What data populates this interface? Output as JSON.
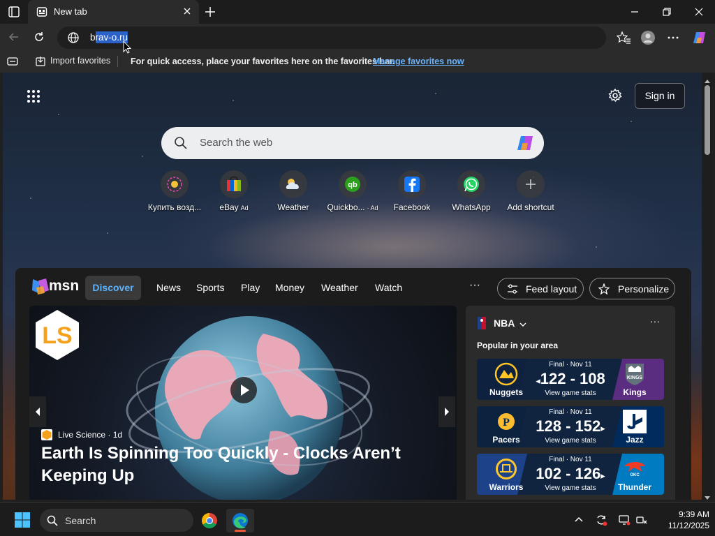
{
  "browser": {
    "tab_title": "New tab",
    "url_prefix": "b",
    "url_selected": "rav-o.ru"
  },
  "favorites_bar": {
    "import_label": "Import favorites",
    "message": "For quick access, place your favorites here on the favorites bar.",
    "manage_link": "Manage favorites now"
  },
  "newtab": {
    "signin_label": "Sign in",
    "search_placeholder": "Search the web",
    "shortcuts": [
      {
        "label": "Купить возд...",
        "ad": ""
      },
      {
        "label": "eBay",
        "ad": "Ad"
      },
      {
        "label": "Weather",
        "ad": ""
      },
      {
        "label": "Quickbo...",
        "ad": "· Ad"
      },
      {
        "label": "Facebook",
        "ad": ""
      },
      {
        "label": "WhatsApp",
        "ad": ""
      },
      {
        "label": "Add shortcut",
        "ad": ""
      }
    ]
  },
  "msn": {
    "logo_text": "msn",
    "tabs": [
      "Discover",
      "News",
      "Sports",
      "Play",
      "Money",
      "Weather",
      "Watch"
    ],
    "more_label": "···",
    "feed_layout_label": "Feed layout",
    "personalize_label": "Personalize",
    "hero": {
      "source": "Live Science · 1d",
      "headline": "Earth Is Spinning Too Quickly - Clocks Aren’t Keeping Up"
    },
    "nba": {
      "title": "NBA",
      "more": "···",
      "popular_label": "Popular in your area",
      "games": [
        {
          "status": "Final · Nov 11",
          "score": "122 - 108",
          "stats": "View game stats",
          "home": "Nuggets",
          "away": "Kings",
          "winner": "left"
        },
        {
          "status": "Final · Nov 11",
          "score": "128 - 152",
          "stats": "View game stats",
          "home": "Pacers",
          "away": "Jazz",
          "winner": "right"
        },
        {
          "status": "Final · Nov 11",
          "score": "102 - 126",
          "stats": "View game stats",
          "home": "Warriors",
          "away": "Thunder",
          "winner": "right"
        }
      ]
    }
  },
  "taskbar": {
    "search_label": "Search",
    "time": "9:39 AM",
    "date": "11/12/2025"
  },
  "colors": {
    "accent_link": "#6ab4ff",
    "discover_text": "#5ab4ff",
    "selection": "#2a62c9",
    "edge_indicator": "#e85a35"
  }
}
